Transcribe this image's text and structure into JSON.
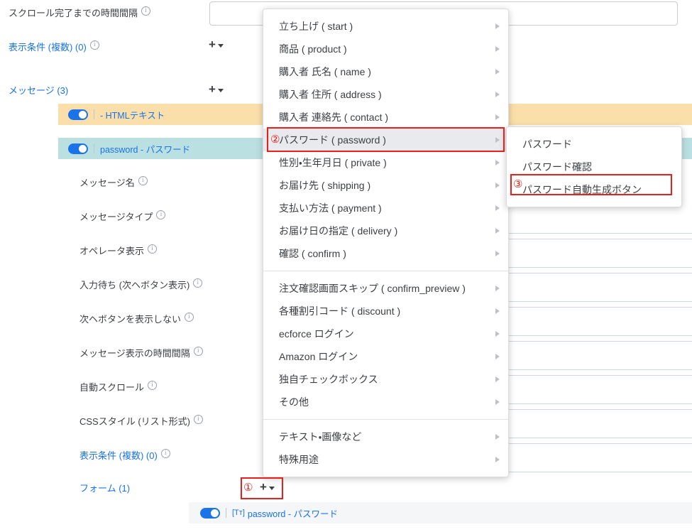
{
  "left_panel": {
    "rows": [
      {
        "label": "スクロール完了までの時間間隔",
        "info": true,
        "link": false,
        "indent": false
      },
      {
        "label": "表示条件 (複数) (0)",
        "info": true,
        "link": true,
        "indent": false
      },
      {
        "label": "メッセージ (3)",
        "info": false,
        "link": true,
        "indent": false
      },
      {
        "label": "メッセージ名",
        "info": true,
        "link": false,
        "indent": true
      },
      {
        "label": "メッセージタイプ",
        "info": true,
        "link": false,
        "indent": true
      },
      {
        "label": "オペレータ表示",
        "info": true,
        "link": false,
        "indent": true
      },
      {
        "label": "入力待ち (次ヘボタン表示)",
        "info": true,
        "link": false,
        "indent": true
      },
      {
        "label": "次ヘボタンを表示しない",
        "info": true,
        "link": false,
        "indent": true
      },
      {
        "label": "メッセージ表示の時間間隔",
        "info": true,
        "link": false,
        "indent": true
      },
      {
        "label": "自動スクロール",
        "info": true,
        "link": false,
        "indent": true
      },
      {
        "label": "CSSスタイル (リスト形式)",
        "info": true,
        "link": false,
        "indent": true
      },
      {
        "label": "表示条件 (複数) (0)",
        "info": true,
        "link": true,
        "indent": true
      },
      {
        "label": "フォーム (1)",
        "info": false,
        "link": true,
        "indent": true
      }
    ]
  },
  "message_rows": [
    {
      "prefix": "",
      "label": "- HTMLテキスト",
      "tone": "orange"
    },
    {
      "prefix": "",
      "label": "password - パスワード",
      "tone": "teal"
    }
  ],
  "form_row": {
    "badge": "[Tᴛ]",
    "label": "password - パスワード"
  },
  "plus_buttons": {
    "display_condition": "+",
    "message": "+",
    "form": "+"
  },
  "context_menu": {
    "groups": [
      {
        "items": [
          {
            "label": "立ち上げ ( start )",
            "has_submenu": true,
            "selected": false
          },
          {
            "label": "商品 ( product )",
            "has_submenu": true,
            "selected": false
          },
          {
            "label": "購入者 氏名 ( name )",
            "has_submenu": true,
            "selected": false
          },
          {
            "label": "購入者 住所 ( address )",
            "has_submenu": true,
            "selected": false
          },
          {
            "label": "購入者 連絡先 ( contact )",
            "has_submenu": true,
            "selected": false
          },
          {
            "label": "パスワード ( password )",
            "has_submenu": true,
            "selected": true
          },
          {
            "label": "性別・生年月日 ( private )",
            "has_submenu": true,
            "selected": false
          },
          {
            "label": "お届け先 ( shipping )",
            "has_submenu": true,
            "selected": false
          },
          {
            "label": "支払い方法 ( payment )",
            "has_submenu": true,
            "selected": false
          },
          {
            "label": "お届け日の指定 ( delivery )",
            "has_submenu": true,
            "selected": false
          },
          {
            "label": "確認 ( confirm )",
            "has_submenu": true,
            "selected": false
          }
        ]
      },
      {
        "items": [
          {
            "label": "注文確認画面スキップ ( confirm_preview )",
            "has_submenu": true,
            "selected": false
          },
          {
            "label": "各種割引コード ( discount )",
            "has_submenu": true,
            "selected": false
          },
          {
            "label": "ecforce ログイン",
            "has_submenu": true,
            "selected": false
          },
          {
            "label": "Amazon ログイン",
            "has_submenu": true,
            "selected": false
          },
          {
            "label": "独自チェックボックス",
            "has_submenu": true,
            "selected": false
          },
          {
            "label": "その他",
            "has_submenu": true,
            "selected": false
          }
        ]
      },
      {
        "items": [
          {
            "label": "テキスト・画像など",
            "has_submenu": true,
            "selected": false
          },
          {
            "label": "特殊用途",
            "has_submenu": true,
            "selected": false
          }
        ]
      }
    ]
  },
  "submenu": {
    "items": [
      {
        "label": "パスワード",
        "highlighted": false
      },
      {
        "label": "パスワード確認",
        "highlighted": false
      },
      {
        "label": "パスワード自動生成ボタン",
        "highlighted": true
      }
    ]
  },
  "annotations": [
    {
      "marker": "①",
      "target": "form-plus-button"
    },
    {
      "marker": "②",
      "target": "menu-item-password"
    },
    {
      "marker": "③",
      "target": "submenu-item-password-autogen"
    }
  ],
  "colors": {
    "accent_blue": "#1a73e8",
    "annotation_red": "#e8201c",
    "row_orange": "#fbdfab",
    "row_teal": "#bbe0e2",
    "menu_selected": "#e8eaed"
  }
}
